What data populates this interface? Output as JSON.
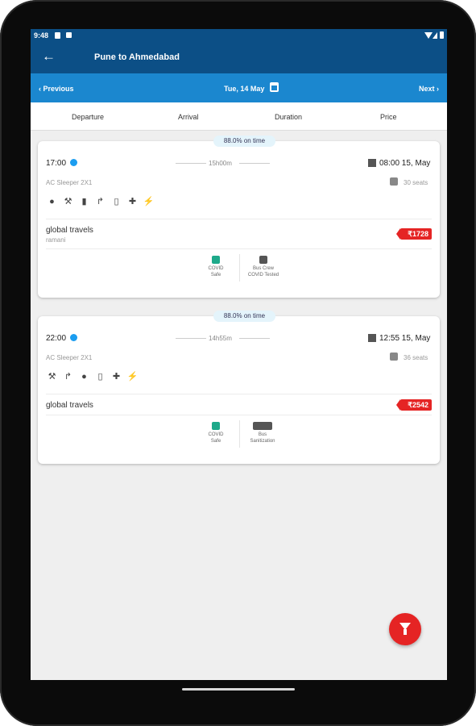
{
  "status_bar": {
    "time": "9:48"
  },
  "app_bar": {
    "back_icon": "←",
    "title": "Pune to Ahmedabad"
  },
  "date_bar": {
    "previous": "‹ Previous",
    "date": "Tue, 14 May",
    "next": "Next ›"
  },
  "sort_bar": {
    "departure": "Departure",
    "arrival": "Arrival",
    "duration": "Duration",
    "price": "Price"
  },
  "buses": [
    {
      "on_time": "88.0% on time",
      "departure": "17:00",
      "duration": "15h00m",
      "arrival": "08:00 15, May",
      "bus_type": "AC Sleeper 2X1",
      "seats": "30 seats",
      "amenities": [
        "location-icon",
        "hammer-icon",
        "bin-icon",
        "reading-light-icon",
        "water-bottle-icon",
        "first-aid-icon",
        "charging-point-icon"
      ],
      "operator": "global travels",
      "operator_sub": "ramani",
      "price": "₹1728",
      "badges": [
        {
          "icon": "shield-icon",
          "text1": "COVID",
          "text2": "Safe",
          "color": "#1da98a"
        },
        {
          "icon": "crew-check-icon",
          "text1": "Bus Crew",
          "text2": "COVID Tested",
          "color": "#555555"
        }
      ]
    },
    {
      "on_time": "88.0% on time",
      "departure": "22:00",
      "duration": "14h55m",
      "arrival": "12:55 15, May",
      "bus_type": "AC Sleeper 2X1",
      "seats": "36 seats",
      "amenities": [
        "hammer-icon",
        "reading-light-icon",
        "location-icon",
        "water-bottle-icon",
        "first-aid-icon",
        "charging-point-icon"
      ],
      "operator": "global travels",
      "operator_sub": "",
      "price": "₹2542",
      "badges": [
        {
          "icon": "shield-icon",
          "text1": "COVID",
          "text2": "Safe",
          "color": "#1da98a"
        },
        {
          "icon": "sanitizer-icon",
          "text1": "Bus",
          "text2": "Sanitization",
          "color": "#555555"
        }
      ]
    }
  ],
  "colors": {
    "app_bar": "#0c4f86",
    "date_bar": "#1b87cf",
    "accent_red": "#e52424",
    "dot_blue": "#1b9df0"
  }
}
